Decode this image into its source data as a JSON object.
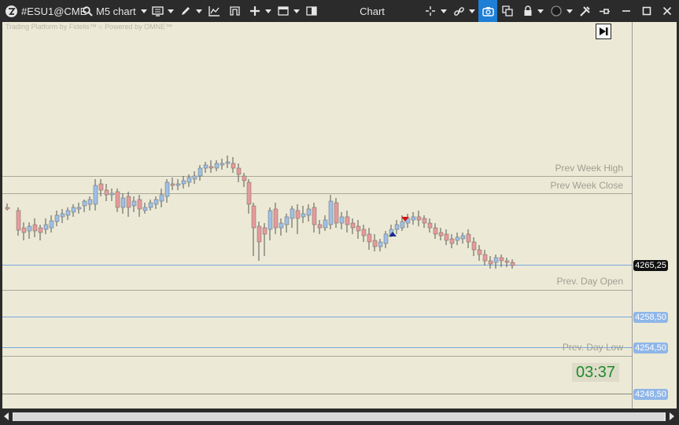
{
  "toolbar": {
    "symbol": "#ESU1@CME",
    "timeframe": "M5 chart",
    "title": "Chart"
  },
  "chart": {
    "watermark": "Trading Platform by Fidelis™  ○ Powered by OMNE™",
    "timer": "03:37",
    "levels": {
      "prev_week_high": "Prev Week High",
      "prev_week_close": "Prev Week Close",
      "prev_day_open": "Prev. Day Open",
      "prev_day_low": "Prev. Day Low"
    },
    "price_labels": {
      "current": "4265,25",
      "level_1": "4258,50",
      "level_2": "4254,50",
      "level_3": "4248,50"
    },
    "colors": {
      "background": "#ecead6",
      "up_candle": "#9ec0e6",
      "down_candle": "#e79a9a",
      "level_line": "#a9a79a",
      "current_line": "#7aa6dc",
      "timer_text": "#1f8a2e"
    }
  }
}
